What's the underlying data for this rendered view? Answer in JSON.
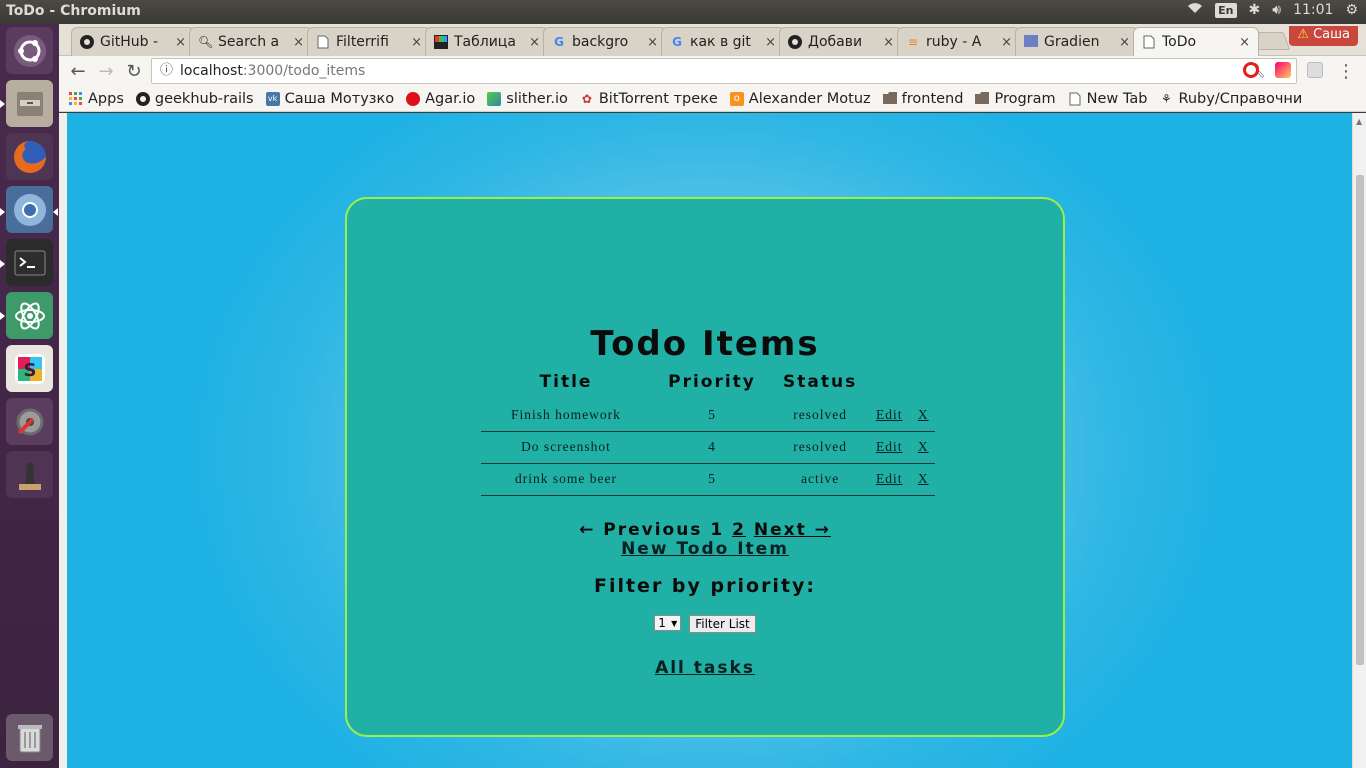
{
  "window": {
    "title": "ToDo - Chromium"
  },
  "system_tray": {
    "keyboard": "En",
    "time": "11:01"
  },
  "tabs": [
    {
      "label": "GitHub -",
      "icon": "github-icon"
    },
    {
      "label": "Search a",
      "icon": "search-icon"
    },
    {
      "label": "Filterrifi",
      "icon": "page-icon"
    },
    {
      "label": "Таблица",
      "icon": "stm-icon"
    },
    {
      "label": "backgro",
      "icon": "google-icon"
    },
    {
      "label": "как в git",
      "icon": "google-icon"
    },
    {
      "label": "Добави",
      "icon": "github-icon"
    },
    {
      "label": "ruby - A",
      "icon": "stackoverflow-icon"
    },
    {
      "label": "Gradien",
      "icon": "page-icon"
    },
    {
      "label": "ToDo",
      "icon": "page-icon",
      "active": true
    }
  ],
  "tab_close": "×",
  "profile": {
    "name": "Саша"
  },
  "omnibox": {
    "host": "localhost",
    "path": ":3000/todo_items"
  },
  "bookmarks": [
    {
      "label": "Apps",
      "icon": "apps-grid-icon"
    },
    {
      "label": "geekhub-rails",
      "icon": "github-icon"
    },
    {
      "label": "Саша Мотузко",
      "icon": "vk-icon"
    },
    {
      "label": "Agar.io",
      "icon": "agar-icon"
    },
    {
      "label": "slither.io",
      "icon": "slither-icon"
    },
    {
      "label": "BitTorrent треке",
      "icon": "bittorrent-icon"
    },
    {
      "label": "Alexander Motuz",
      "icon": "odnoklassniki-icon"
    },
    {
      "label": "frontend",
      "icon": "folder-icon"
    },
    {
      "label": "Program",
      "icon": "folder-icon"
    },
    {
      "label": "New Tab",
      "icon": "page-icon"
    },
    {
      "label": "Ruby/Справочни",
      "icon": "wiki-icon"
    }
  ],
  "page": {
    "title": "Todo Items",
    "columns": {
      "title": "Title",
      "priority": "Priority",
      "status": "Status"
    },
    "rows": [
      {
        "title": "Finish homework",
        "priority": "5",
        "status": "resolved",
        "edit": "Edit",
        "delete": "X"
      },
      {
        "title": "Do screenshot",
        "priority": "4",
        "status": "resolved",
        "edit": "Edit",
        "delete": "X"
      },
      {
        "title": "drink some beer",
        "priority": "5",
        "status": "active",
        "edit": "Edit",
        "delete": "X"
      }
    ],
    "pagination": {
      "prev": "← Previous",
      "page1": "1",
      "page2": "2",
      "next": "Next →"
    },
    "new_link": "New Todo Item",
    "filter_heading": "Filter by priority:",
    "filter_select_value": "1",
    "filter_button": "Filter List",
    "all_tasks": "All tasks"
  },
  "colors": {
    "card_bg": "#21b0a5",
    "card_border": "#9af04a",
    "page_bg": "#1eb2e4",
    "launcher_bg": "#4a2a4e"
  }
}
